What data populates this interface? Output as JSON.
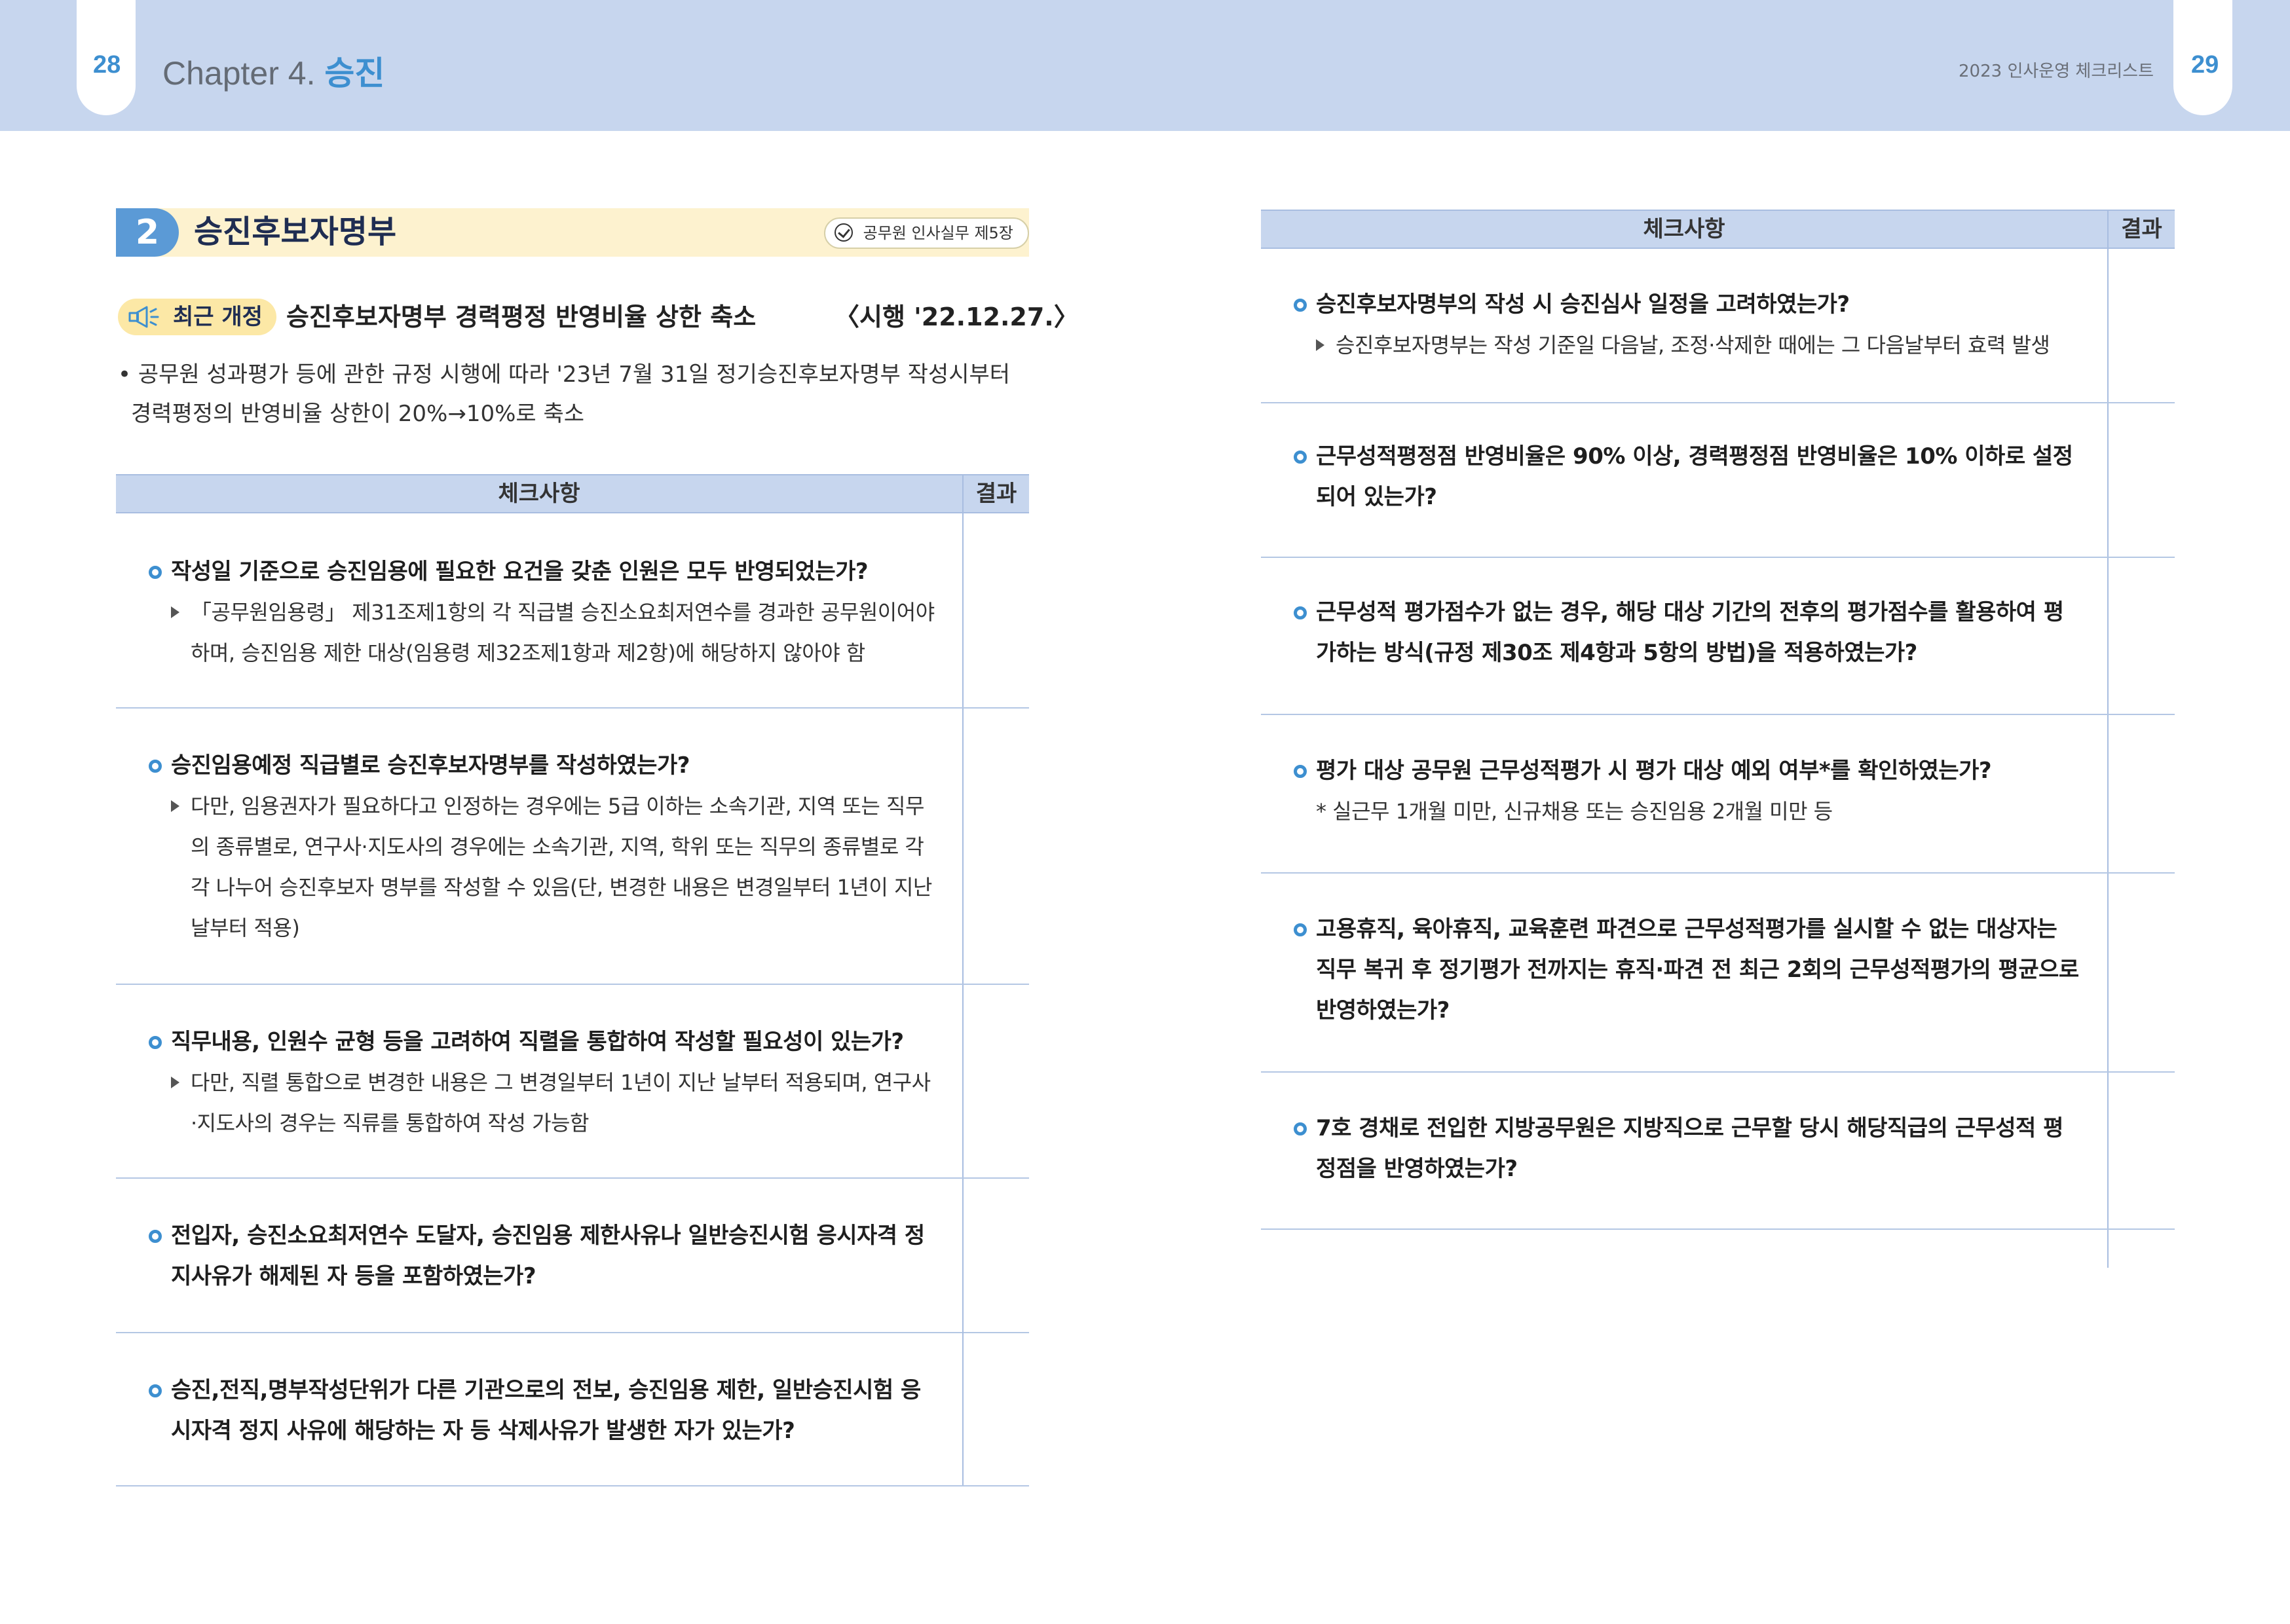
{
  "header": {
    "left_page_number": "28",
    "right_page_number": "29",
    "chapter_prefix": "Chapter 4.",
    "chapter_name": "승진",
    "running_title": "2023 인사운영 체크리스트"
  },
  "section": {
    "number": "2",
    "title": "승진후보자명부",
    "reference": "공무원 인사실무 제5장"
  },
  "revision": {
    "badge": "최근 개정",
    "title": "승진후보자명부 경력평정 반영비율 상한 축소",
    "date": "〈시행 '22.12.27.〉",
    "body": "• 공무원 성과평가 등에 관한 규정 시행에 따라 '23년 7월 31일 정기승진후보자명부 작성시부터 경력평정의 반영비율 상한이 20%→10%로 축소"
  },
  "table_headers": {
    "check": "체크사항",
    "result": "결과"
  },
  "left_items": [
    {
      "question": "작성일 기준으로 승진임용에 필요한 요건을 갖춘 인원은 모두 반영되었는가?",
      "detail": "「공무원임용령」 제31조제1항의 각 직급별 승진소요최저연수를 경과한 공무원이어야 하며, 승진임용 제한 대상(임용령 제32조제1항과 제2항)에 해당하지 않아야 함"
    },
    {
      "question": "승진임용예정 직급별로 승진후보자명부를 작성하였는가?",
      "detail": "다만, 임용권자가 필요하다고 인정하는 경우에는 5급 이하는 소속기관, 지역 또는 직무의 종류별로, 연구사·지도사의 경우에는 소속기관, 지역, 학위 또는 직무의 종류별로 각각 나누어 승진후보자 명부를 작성할 수 있음(단, 변경한 내용은 변경일부터 1년이 지난 날부터 적용)"
    },
    {
      "question": "직무내용, 인원수 균형 등을 고려하여 직렬을 통합하여 작성할 필요성이 있는가?",
      "detail": "다만, 직렬 통합으로 변경한 내용은 그 변경일부터 1년이 지난 날부터 적용되며, 연구사·지도사의 경우는 직류를 통합하여 작성 가능함"
    },
    {
      "question": "전입자, 승진소요최저연수 도달자, 승진임용 제한사유나 일반승진시험 응시자격 정지사유가 해제된 자 등을 포함하였는가?",
      "detail": ""
    },
    {
      "question": "승진,전직,명부작성단위가 다른 기관으로의 전보, 승진임용 제한, 일반승진시험 응시자격 정지 사유에 해당하는 자 등 삭제사유가 발생한 자가 있는가?",
      "detail": ""
    }
  ],
  "right_items": [
    {
      "question": "승진후보자명부의 작성 시 승진심사 일정을 고려하였는가?",
      "detail": "승진후보자명부는 작성 기준일 다음날, 조정·삭제한 때에는 그 다음날부터 효력 발생",
      "note": ""
    },
    {
      "question": "근무성적평정점 반영비율은 90% 이상, 경력평정점 반영비율은 10% 이하로 설정되어 있는가?",
      "detail": "",
      "note": ""
    },
    {
      "question": "근무성적 평가점수가 없는 경우, 해당 대상 기간의 전후의 평가점수를 활용하여 평가하는 방식(규정 제30조 제4항과 5항의 방법)을 적용하였는가?",
      "detail": "",
      "note": ""
    },
    {
      "question": "평가 대상 공무원 근무성적평가 시 평가 대상 예외 여부*를 확인하였는가?",
      "detail": "",
      "note": "* 실근무 1개월 미만, 신규채용 또는 승진임용 2개월 미만 등"
    },
    {
      "question": "고용휴직, 육아휴직, 교육훈련 파견으로 근무성적평가를 실시할 수 없는 대상자는 직무 복귀 후 정기평가 전까지는 휴직·파견 전 최근 2회의 근무성적평가의 평균으로 반영하였는가?",
      "detail": "",
      "note": ""
    },
    {
      "question": "7호 경채로 전입한 지방공무원은 지방직으로 근무할 당시 해당직급의 근무성적 평정점을 반영하였는가?",
      "detail": "",
      "note": ""
    }
  ]
}
